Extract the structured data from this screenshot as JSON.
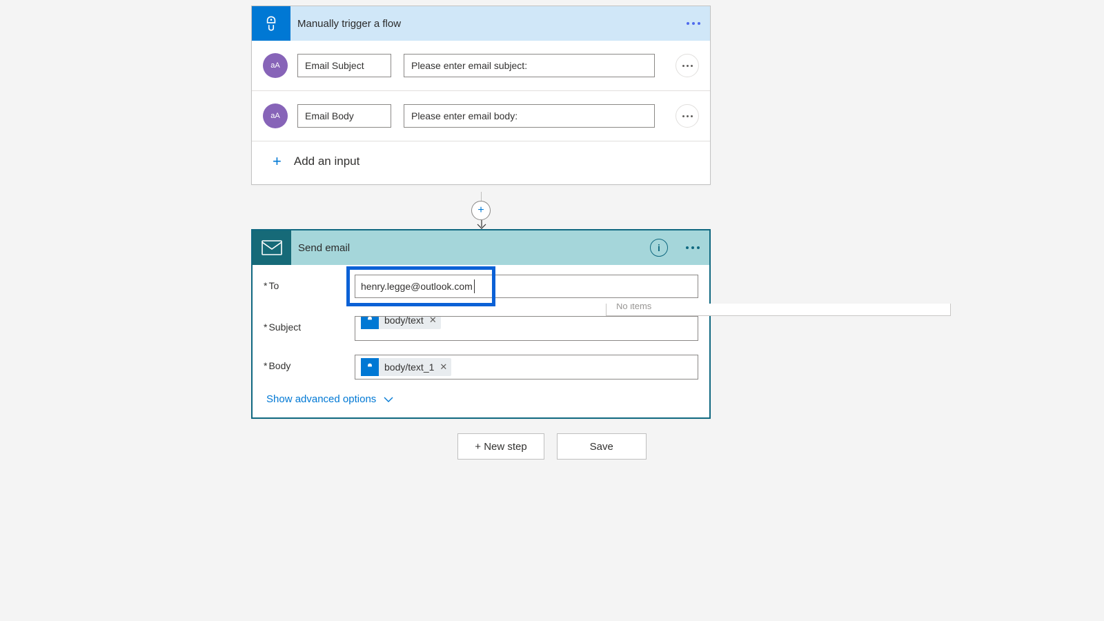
{
  "trigger": {
    "title": "Manually trigger a flow",
    "typeBadge": "aA",
    "inputs": [
      {
        "name": "Email Subject",
        "placeholder": "Please enter email subject:"
      },
      {
        "name": "Email Body",
        "placeholder": "Please enter email body:"
      }
    ],
    "addInputLabel": "Add an input"
  },
  "action": {
    "title": "Send email",
    "fields": {
      "to": {
        "label": "To",
        "value": "henry.legge@outlook.com"
      },
      "subject": {
        "label": "Subject",
        "token": "body/text"
      },
      "body": {
        "label": "Body",
        "token": "body/text_1"
      }
    },
    "dropdownText": "No items",
    "advancedLabel": "Show advanced options"
  },
  "buttons": {
    "newStep": "+ New step",
    "save": "Save"
  }
}
